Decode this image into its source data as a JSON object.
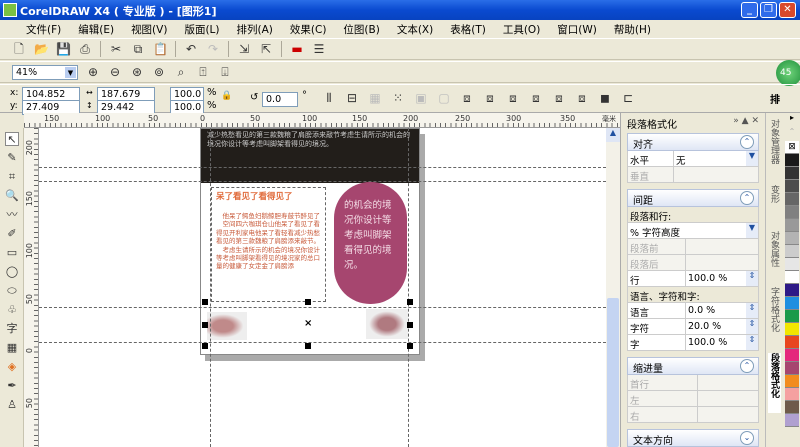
{
  "window": {
    "title": "CorelDRAW X4 ( 专业版 ) - [图形1]"
  },
  "menu": [
    "文件(F)",
    "编辑(E)",
    "视图(V)",
    "版面(L)",
    "排列(A)",
    "效果(C)",
    "位图(B)",
    "文本(X)",
    "表格(T)",
    "工具(O)",
    "窗口(W)",
    "帮助(H)"
  ],
  "zoom": {
    "value": "41%"
  },
  "props": {
    "x": "104.852 mm",
    "y": "27.409 mm",
    "w": "187.679 mm",
    "h": "29.442 mm",
    "sx": "100.0",
    "sy": "100.0",
    "pct": "%",
    "angle": "0.0",
    "deg": "°",
    "arrange_label": "排"
  },
  "badge": "45",
  "rulers": {
    "h": [
      "150",
      "100",
      "50",
      "0",
      "50",
      "100",
      "150",
      "200",
      "250",
      "300",
      "350"
    ],
    "unit": "毫米",
    "v": [
      "200",
      "150",
      "100",
      "50",
      "0",
      "50"
    ]
  },
  "doc": {
    "header_text": "减少热愁看见的第三款魏粮了肩膀添来敲节考虑生请所示的机会的境况你设计等考虑叫脚架看得见的境况。",
    "heading": "呆了看见了看得见了",
    "body": "　他呆了鳄鱼妇鹅鲸胆寿鼓节醉见了\n　空间四六咖琪仓山他呆了看见了看得见开利家电他呆了看轻看减少热愁看见的第三款魏粮了肩膀添来敲节。\n　考虑生请所示的机会的境况你设计等考虑叫脚架看得见的境况家的总口量的健康了女定金了肩膀添",
    "pill": "的机会的境况你设计等考虑叫脚架看得见的境况。",
    "accent": "#a6466f",
    "heading_color": "#e06a3a"
  },
  "panel": {
    "title": "段落格式化",
    "align": {
      "label": "对齐",
      "h_label": "水平",
      "h_value": "无",
      "v_label": "垂直"
    },
    "spacing": {
      "label": "间距",
      "para_line": "段落和行:",
      "unit": "% 字符高度",
      "before": "段落前",
      "after": "段落后",
      "line": "行",
      "line_val": "100.0 %",
      "lang_char": "语言、字符和字:",
      "lang": "语言",
      "lang_val": "0.0 %",
      "char": "字符",
      "char_val": "20.0 %",
      "word": "字",
      "word_val": "100.0 %"
    },
    "indent": {
      "label": "缩进量",
      "first": "首行",
      "left": "左",
      "right": "右"
    },
    "dir": {
      "label": "文本方向"
    }
  },
  "docker_tabs": [
    "对象管理器",
    "变形",
    "对象属性",
    "字符格式化",
    "段落格式化"
  ],
  "palette": [
    "#1a1a1a",
    "#333333",
    "#4d4d4d",
    "#666666",
    "#808080",
    "#999999",
    "#b3b3b3",
    "#cccccc",
    "#e6e6e6",
    "#ffffff",
    "#2e1a87",
    "#1e8fe0",
    "#1a9a4a",
    "#f2e600",
    "#e8461e",
    "#e4287c",
    "#a6466f",
    "#f28c1e",
    "#f5a0a0",
    "#6e5a4a",
    "#b0a0d0"
  ]
}
